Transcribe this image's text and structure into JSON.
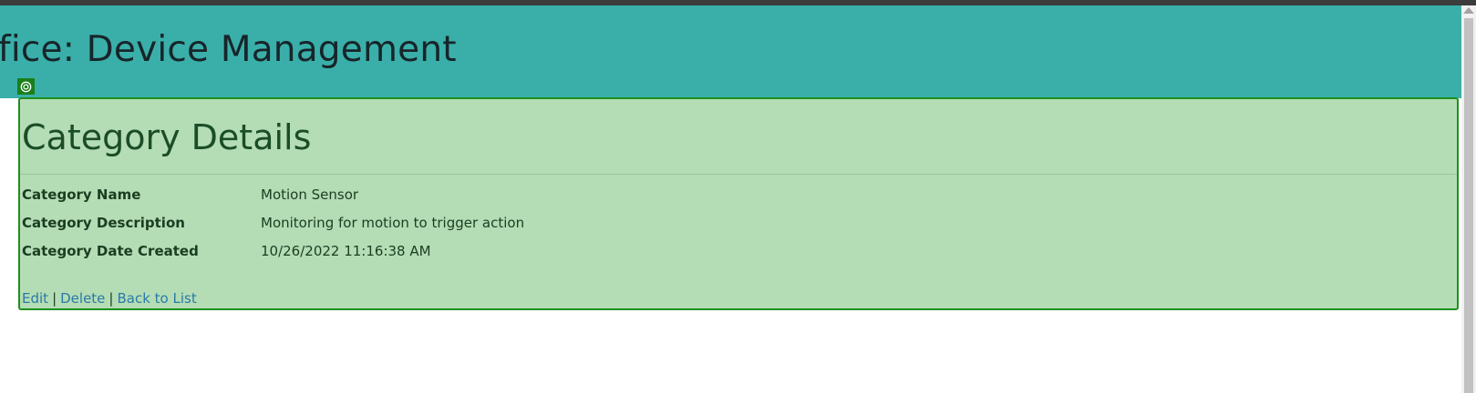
{
  "header": {
    "title": "ffice: Device Management"
  },
  "details": {
    "title": "Category Details",
    "fields": [
      {
        "label": "Category Name",
        "value": "Motion Sensor"
      },
      {
        "label": "Category Description",
        "value": "Monitoring for motion to trigger action"
      },
      {
        "label": "Category Date Created",
        "value": "10/26/2022 11:16:38 AM"
      }
    ]
  },
  "actions": {
    "edit": "Edit",
    "delete": "Delete",
    "back": "Back to List",
    "separator": "|"
  },
  "colors": {
    "header_bg": "#3aafa9",
    "header_text": "#17252a",
    "panel_bg": "#b4ddb5",
    "panel_border": "#1f8f1f",
    "link": "#2a7aa8"
  },
  "icons": {
    "inspect": "target-icon"
  }
}
